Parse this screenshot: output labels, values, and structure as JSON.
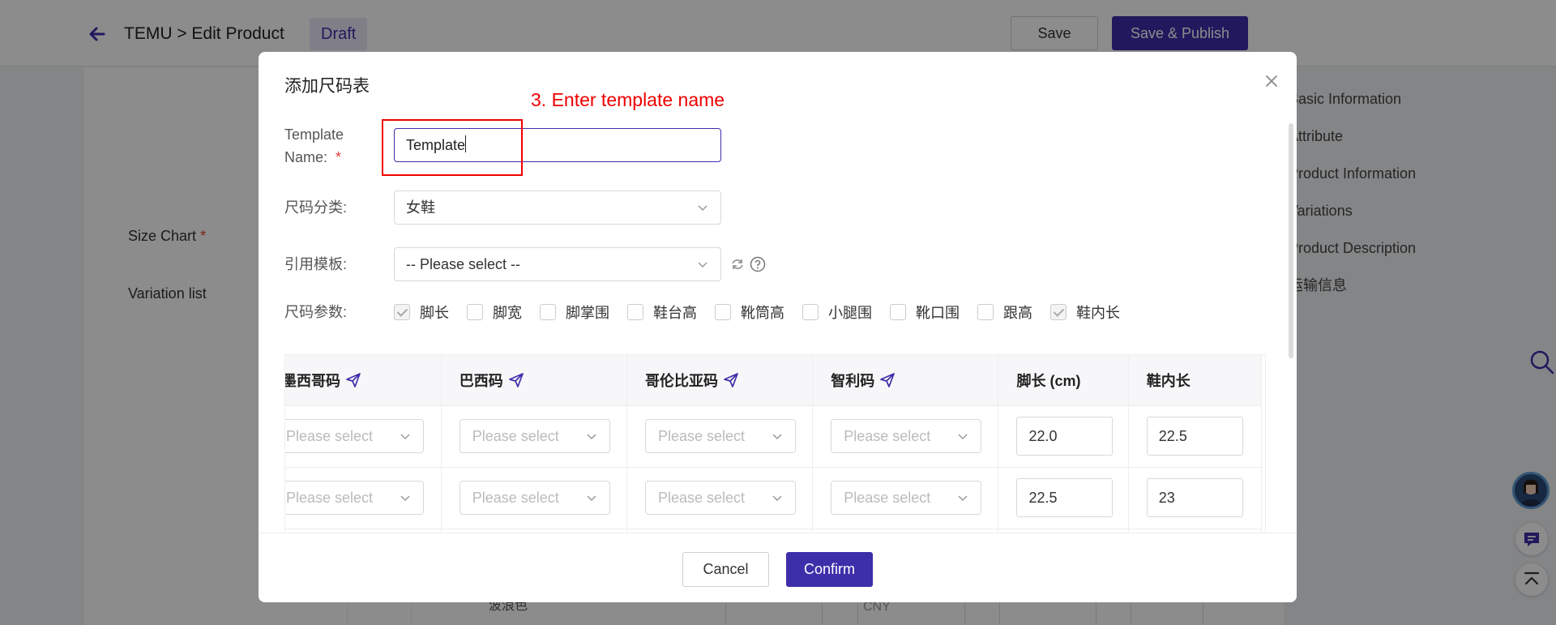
{
  "topbar": {
    "breadcrumb": "TEMU > Edit Product",
    "status_badge": "Draft",
    "save_label": "Save",
    "publish_label": "Save & Publish"
  },
  "background": {
    "size_chart_label": "Size Chart",
    "variation_list_label": "Variation list",
    "required_mark": "*",
    "bottom_fragment_1": "波浪色",
    "bottom_fragment_2": "CNY",
    "anchor_nav": [
      "Basic Information",
      "Attribute",
      "Product Information",
      "Variations",
      "Product Description",
      "运输信息"
    ]
  },
  "modal": {
    "title": "添加尺码表",
    "annotation": "3. Enter template name",
    "template_name_label_1": "Template",
    "template_name_label_2": "Name:",
    "required_mark": "*",
    "template_name_value": "Template",
    "size_category_label": "尺码分类:",
    "size_category_value": "女鞋",
    "reference_template_label": "引用模板:",
    "reference_template_placeholder": "-- Please select --",
    "size_params_label": "尺码参数:",
    "size_params": [
      {
        "label": "脚长",
        "checked": true
      },
      {
        "label": "脚宽",
        "checked": false
      },
      {
        "label": "脚掌围",
        "checked": false
      },
      {
        "label": "鞋台高",
        "checked": false
      },
      {
        "label": "靴筒高",
        "checked": false
      },
      {
        "label": "小腿围",
        "checked": false
      },
      {
        "label": "靴口围",
        "checked": false
      },
      {
        "label": "跟高",
        "checked": false
      },
      {
        "label": "鞋内长",
        "checked": true
      }
    ],
    "table": {
      "headers": [
        "墨西哥码",
        "巴西码",
        "哥伦比亚码",
        "智利码",
        "脚长 (cm)",
        "鞋内长"
      ],
      "select_placeholder": "Please select",
      "rows": [
        {
          "foot_length": "22.0",
          "inner_length": "22.5"
        },
        {
          "foot_length": "22.5",
          "inner_length": "23"
        }
      ]
    },
    "cancel_label": "Cancel",
    "confirm_label": "Confirm"
  },
  "colors": {
    "brand": "#3d2eaa",
    "annotation": "#e00000",
    "required": "#e53935"
  }
}
